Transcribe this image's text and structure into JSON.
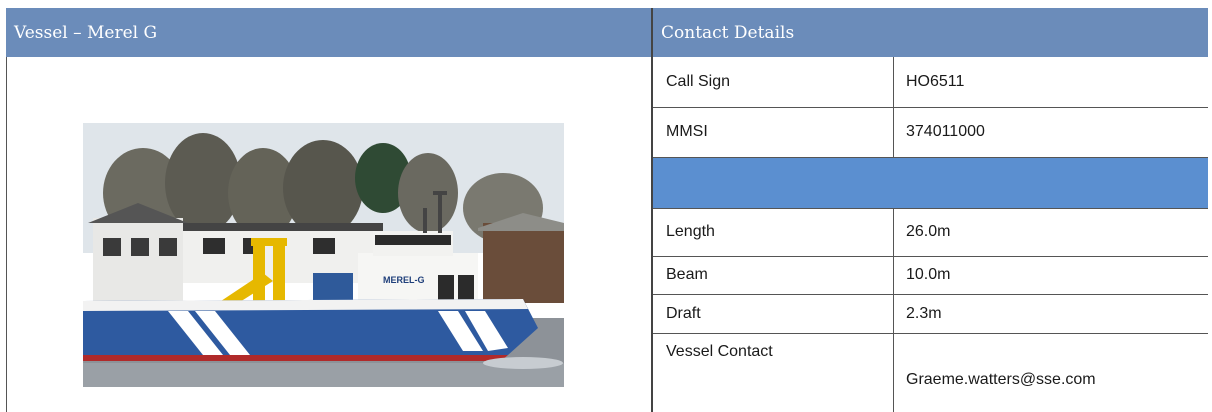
{
  "header": {
    "vessel_title": "Vessel – Merel G",
    "contact_title": "Contact Details"
  },
  "photo": {
    "hull_text": "MEREL-G"
  },
  "details": {
    "rows": [
      {
        "label": "Call Sign",
        "value": "HO6511"
      },
      {
        "label": "MMSI",
        "value": "374011000"
      },
      {
        "label": "Length",
        "value": "26.0m"
      },
      {
        "label": "Beam",
        "value": "10.0m"
      },
      {
        "label": "Draft",
        "value": "2.3m"
      },
      {
        "label": "Vessel Contact",
        "value": "Graeme.watters@sse.com"
      }
    ]
  },
  "colors": {
    "header_bg": "#6b8cba",
    "band_bg": "#5b8fd0"
  }
}
